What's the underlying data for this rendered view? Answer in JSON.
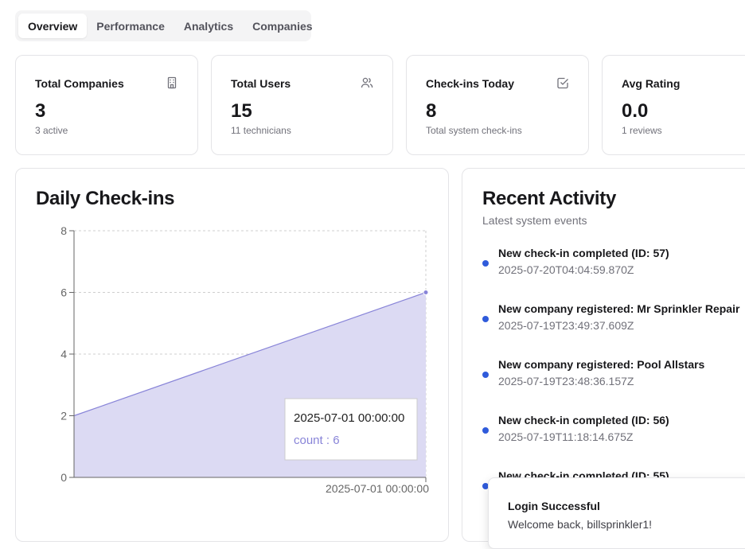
{
  "tabs": [
    {
      "label": "Overview",
      "active": true
    },
    {
      "label": "Performance",
      "active": false
    },
    {
      "label": "Analytics",
      "active": false
    },
    {
      "label": "Companies",
      "active": false
    }
  ],
  "stats": [
    {
      "label": "Total Companies",
      "value": "3",
      "sub": "3 active",
      "icon": "building-icon"
    },
    {
      "label": "Total Users",
      "value": "15",
      "sub": "11 technicians",
      "icon": "users-icon"
    },
    {
      "label": "Check-ins Today",
      "value": "8",
      "sub": "Total system check-ins",
      "icon": "check-square-icon"
    },
    {
      "label": "Avg Rating",
      "value": "0.0",
      "sub": "1 reviews",
      "icon": "star-icon"
    }
  ],
  "chart": {
    "title": "Daily Check-ins",
    "tooltip": {
      "date": "2025-07-01 00:00:00",
      "label": "count : 6"
    }
  },
  "chart_data": {
    "type": "area",
    "title": "Daily Check-ins",
    "x": [
      "",
      "2025-07-01 00:00:00"
    ],
    "x_tick_labels": [
      "2025-07-01 00:00:00"
    ],
    "series": [
      {
        "name": "count",
        "values": [
          2,
          6
        ]
      }
    ],
    "ylim": [
      0,
      8
    ],
    "yticks": [
      0,
      2,
      4,
      6,
      8
    ],
    "grid": true,
    "colors": {
      "fill": "#dcdaf3",
      "stroke": "#8884d8"
    }
  },
  "activity": {
    "title": "Recent Activity",
    "subtitle": "Latest system events",
    "items": [
      {
        "text": "New check-in completed (ID: 57)",
        "time": "2025-07-20T04:04:59.870Z"
      },
      {
        "text": "New company registered: Mr Sprinkler Repair",
        "time": "2025-07-19T23:49:37.609Z"
      },
      {
        "text": "New company registered: Pool Allstars",
        "time": "2025-07-19T23:48:36.157Z"
      },
      {
        "text": "New check-in completed (ID: 56)",
        "time": "2025-07-19T11:18:14.675Z"
      },
      {
        "text": "New check-in completed (ID: 55)",
        "time": ""
      }
    ]
  },
  "toast": {
    "title": "Login Successful",
    "message": "Welcome back, billsprinkler1!"
  },
  "colors": {
    "accent": "#2f5bdb",
    "chart_stroke": "#8884d8",
    "chart_fill": "#dcdaf3"
  }
}
